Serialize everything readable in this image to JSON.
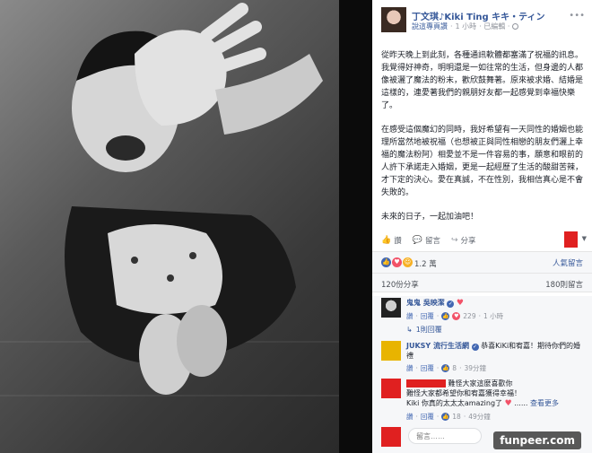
{
  "post": {
    "author": "丁文琪♪Kiki Ting キキ・ティン",
    "follow_label": "說這專頁讚",
    "separator": "·",
    "time": "1 小時",
    "edited": "· 已編輯 ·",
    "paragraphs": [
      "從昨天晚上到此刻，各種通訊軟體都塞滿了祝福的訊息。我覺得好神奇，明明還是一如往常的生活，但身邊的人都像被灑了魔法的粉末，歡欣鼓舞著。原來被求婚、結婚是這樣的，連愛著我們的親朋好友都一起感覺到幸福快樂了。",
      "在感受這個魔幻的同時，我好希望有一天同性的婚姻也能理所當然地被祝福（也想被正與同性相戀的朋友們灑上幸福的魔法粉阿）相愛並不是一件容易的事，願意和眼前的人許下承諾走入婚姻，更是一起經歷了生活的酸甜苦辣，才下定的決心。愛在真誠，不在性別，我相信真心是不會失敗的。",
      "未來的日子，一起加油吧！"
    ]
  },
  "actions": {
    "like": "讚",
    "comment": "留言",
    "share": "分享"
  },
  "reactions": {
    "count": "1.2 萬",
    "sort": "人氣留言"
  },
  "stats": {
    "shares": "120份分享",
    "comments": "180則留言"
  },
  "comments": [
    {
      "name": "鬼鬼 吳映潔",
      "text": "",
      "like_label": "讚",
      "reply_label": "回覆",
      "reaction_count": "229",
      "time": "1 小時",
      "replies": "1則回覆"
    },
    {
      "name": "JUKSY 流行生活網",
      "text": "恭喜KiKi和宥嘉！期待你們的婚禮",
      "like_label": "讚",
      "reply_label": "回覆",
      "reaction_count": "8",
      "time": "39分鐘"
    },
    {
      "name": "",
      "line1": "難怪大家這麼喜歡你",
      "line2": "難怪大家都希望你和宥嘉獲得幸福！",
      "line3": "Kiki 你真的太太太amazing了",
      "ellipsis": "......",
      "see_more": "查看更多",
      "like_label": "讚",
      "reply_label": "回覆",
      "reaction_count": "18",
      "time": "49分鐘"
    }
  ],
  "input": {
    "placeholder": "留言……"
  },
  "watermark": "funpeer.com",
  "icons": {
    "globe": "globe-icon",
    "more": "more-icon",
    "like": "thumbs-up-icon",
    "comment": "comment-icon",
    "share": "share-icon"
  },
  "colors": {
    "link": "#365899",
    "accent_red": "#e02020"
  }
}
